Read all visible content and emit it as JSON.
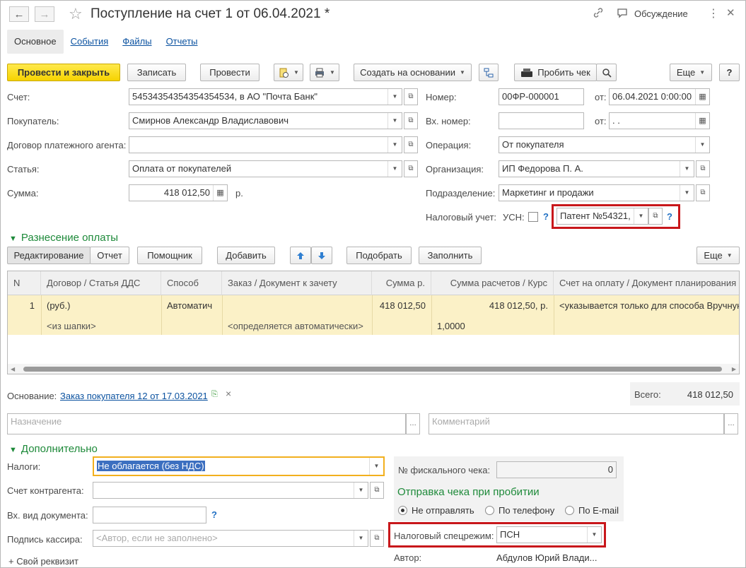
{
  "header": {
    "title": "Поступление на счет 1 от 06.04.2021 *",
    "back": "←",
    "forward": "→",
    "star": "☆",
    "discussion": "Обсуждение",
    "menu": "⋮",
    "close": "✕"
  },
  "tabs": [
    {
      "label": "Основное"
    },
    {
      "label": "События"
    },
    {
      "label": "Файлы"
    },
    {
      "label": "Отчеты"
    }
  ],
  "toolbar": {
    "post_close": "Провести и закрыть",
    "save": "Записать",
    "post": "Провести",
    "create_based": "Создать на основании",
    "print_receipt": "Пробить чек",
    "more": "Еще",
    "help": "?"
  },
  "form": {
    "account_label": "Счет:",
    "account_value": "54534354354354354534, в АО \"Почта Банк\"",
    "buyer_label": "Покупатель:",
    "buyer_value": "Смирнов Александр Владиславович",
    "agent_contract_label": "Договор платежного агента:",
    "agent_contract_value": "",
    "article_label": "Статья:",
    "article_value": "Оплата от покупателей",
    "sum_label": "Сумма:",
    "sum_value": "418 012,50",
    "sum_unit": "р.",
    "number_label": "Номер:",
    "number_value": "00ФР-000001",
    "from_label": "от:",
    "date_value": "06.04.2021  0:00:00",
    "in_number_label": "Вх. номер:",
    "in_number_value": "",
    "in_from_label": "от:",
    "in_date_value": " .  .",
    "operation_label": "Операция:",
    "operation_value": "От покупателя",
    "org_label": "Организация:",
    "org_value": "ИП Федорова П. А.",
    "dept_label": "Подразделение:",
    "dept_value": "Маркетинг и продажи",
    "tax_label": "Налоговый учет:",
    "usn_label": "УСН:",
    "patent_value": "Патент №54321,"
  },
  "payment": {
    "section_title": "Разнесение оплаты",
    "edit_tab": "Редактирование",
    "report_tab": "Отчет",
    "assistant": "Помощник",
    "add": "Добавить",
    "pick": "Подобрать",
    "fill": "Заполнить",
    "more": "Еще",
    "columns": [
      "N",
      "Договор / Статья ДДС",
      "Способ",
      "Заказ / Документ к зачету",
      "Сумма р.",
      "Сумма расчетов / Курс",
      "Счет на оплату / Документ планирования"
    ],
    "row": {
      "n": "1",
      "contract": "(руб.)",
      "contract_sub": "<из шапки>",
      "method": "Автоматич",
      "order_sub": "<определяется автоматически>",
      "sum": "418 012,50",
      "calc_sum": "418 012,50, р.",
      "rate": "1,0000",
      "invoice": "<указывается только для способа Вручную"
    }
  },
  "basis": {
    "label": "Основание:",
    "link": "Заказ покупателя 12 от 17.03.2021",
    "remove": "×",
    "total_label": "Всего:",
    "total_value": "418 012,50"
  },
  "purpose_placeholder": "Назначение",
  "comment_placeholder": "Комментарий",
  "additional": {
    "section_title": "Дополнительно",
    "taxes_label": "Налоги:",
    "taxes_value": "Не облагается (без НДС)",
    "counterparty_account_label": "Счет контрагента:",
    "in_doc_type_label": "Вх. вид документа:",
    "cashier_label": "Подпись кассира:",
    "cashier_placeholder": "<Автор, если не заполнено>",
    "own_attr": "+ Свой реквизит",
    "fiscal_label": "№ фискального чека:",
    "fiscal_value": "0",
    "receipt_title": "Отправка чека при пробитии",
    "radio_none": "Не отправлять",
    "radio_phone": "По телефону",
    "radio_email": "По E-mail",
    "tax_regime_label": "Налоговый спецрежим:",
    "tax_regime_value": "ПСН",
    "author_label": "Автор:",
    "author_value": "Абдулов Юрий Влади..."
  },
  "colors": {
    "primary": "#f6d300",
    "section": "#1e8a3a",
    "link": "#0b52a0",
    "highlight_frame": "#c8171b",
    "row_selected": "#fbf1c7"
  }
}
